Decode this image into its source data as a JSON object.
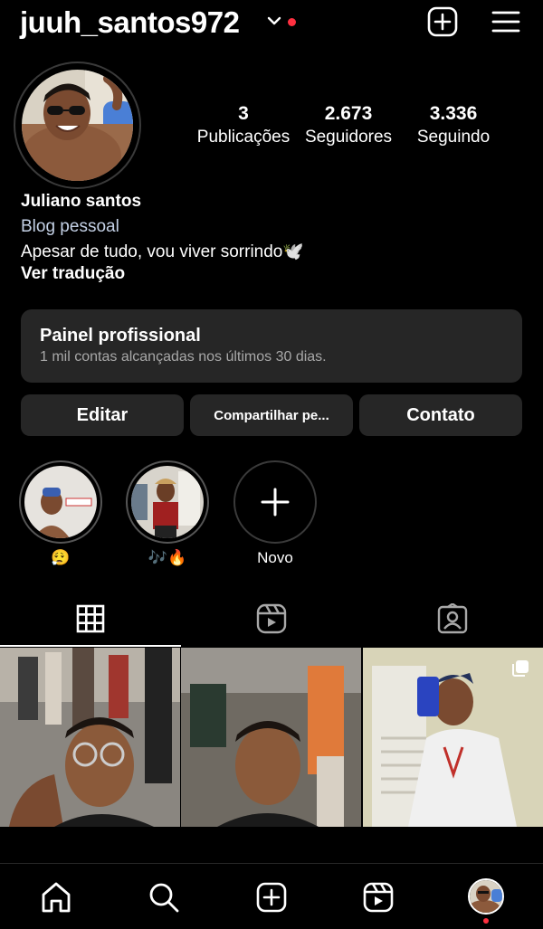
{
  "header": {
    "username": "juuh_santos972",
    "icons": [
      "chevron-down-icon",
      "add-post-icon",
      "menu-icon"
    ]
  },
  "profile": {
    "stats": [
      {
        "value": "3",
        "label": "Publicações"
      },
      {
        "value": "2.673",
        "label": "Seguidores"
      },
      {
        "value": "3.336",
        "label": "Seguindo"
      }
    ],
    "name": "Juliano santos",
    "category": "Blog pessoal",
    "bio": "Apesar de tudo, vou viver sorrindo🕊️",
    "translate_label": "Ver tradução"
  },
  "dashboard": {
    "title": "Painel profissional",
    "subtitle": "1 mil contas alcançadas nos últimos 30 dias."
  },
  "buttons": {
    "edit": "Editar",
    "share": "Compartilhar pe...",
    "contact": "Contato"
  },
  "highlights": [
    {
      "label": "😮‍💨"
    },
    {
      "label": "🎶🔥"
    },
    {
      "label": "Novo"
    }
  ],
  "tabs": [
    "grid-icon",
    "reels-icon",
    "tagged-icon"
  ],
  "bottom_nav": [
    "home-icon",
    "search-icon",
    "create-icon",
    "reels-icon",
    "profile-avatar"
  ],
  "colors": {
    "background": "#000000",
    "surface": "#262626",
    "accent_red": "#ff3040",
    "category_text": "#c4d1e6",
    "secondary_text": "#a8a8a8"
  }
}
